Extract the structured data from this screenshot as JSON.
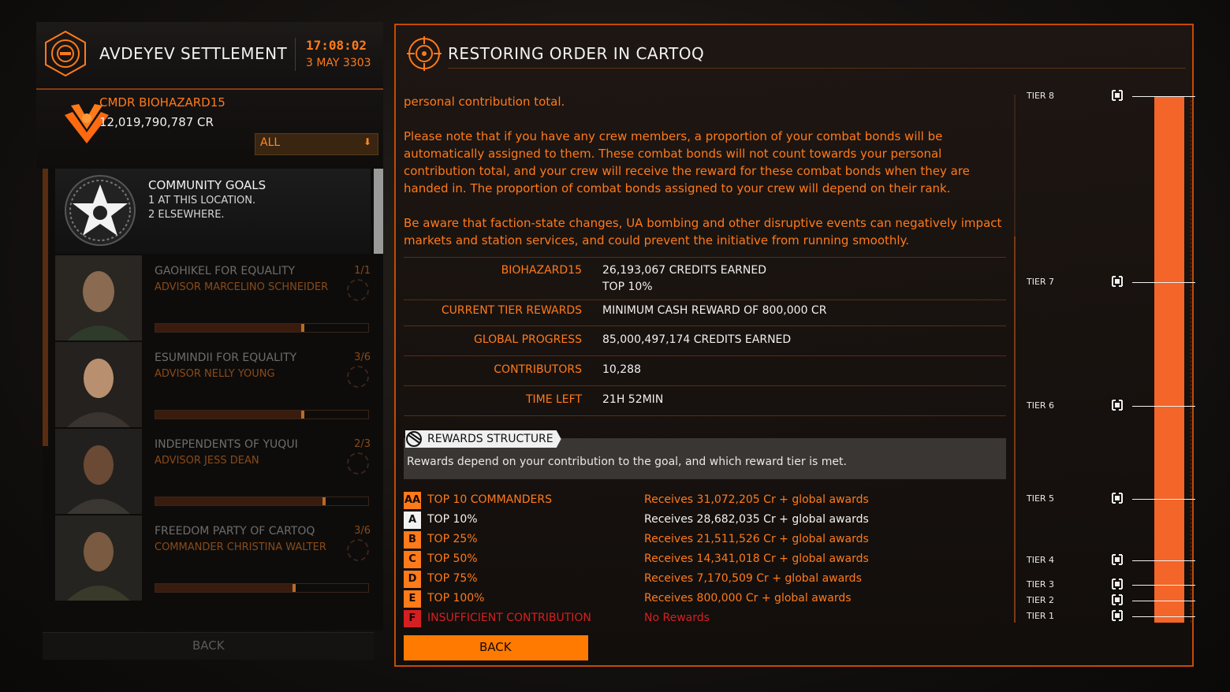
{
  "station": {
    "name": "AVDEYEV SETTLEMENT",
    "time": "17:08:02",
    "date": "3 MAY 3303"
  },
  "commander": {
    "name": "CMDR BIOHAZARD15",
    "credits": "12,019,790,787 CR",
    "filter": "ALL"
  },
  "community_goals": {
    "title": "COMMUNITY GOALS",
    "line1": "1 AT THIS LOCATION.",
    "line2": "2 ELSEWHERE."
  },
  "factions": [
    {
      "name": "GAOHIKEL FOR EQUALITY",
      "advisor": "ADVISOR MARCELINO SCHNEIDER",
      "count": "1/1",
      "progress": 0.7
    },
    {
      "name": "ESUMINDII FOR EQUALITY",
      "advisor": "ADVISOR NELLY YOUNG",
      "count": "3/6",
      "progress": 0.7
    },
    {
      "name": "INDEPENDENTS OF YUQUI",
      "advisor": "ADVISOR JESS DEAN",
      "count": "2/3",
      "progress": 0.8
    },
    {
      "name": "FREEDOM PARTY OF CARTOQ",
      "advisor": "COMMANDER CHRISTINA WALTER",
      "count": "3/6",
      "progress": 0.66
    }
  ],
  "left_back": "BACK",
  "goal": {
    "title": "RESTORING ORDER IN CARTOQ",
    "desc1": "personal contribution total.",
    "desc2": "Please note that if you have any crew members, a proportion of your combat bonds will be automatically assigned to them. These combat bonds will not count towards your personal contribution total, and your crew will receive the reward for these combat bonds when they are handed in. The proportion of combat bonds assigned to your crew will depend on their rank.",
    "desc3": "Be aware that faction-state changes, UA bombing and other disruptive events can negatively impact markets and station services, and could prevent the initiative from running smoothly."
  },
  "stats": [
    {
      "label": "BIOHAZARD15",
      "value": "26,193,067 CREDITS EARNED",
      "value2": "TOP 10%"
    },
    {
      "label": "CURRENT TIER REWARDS",
      "value": "MINIMUM CASH REWARD OF 800,000 CR"
    },
    {
      "label": "GLOBAL PROGRESS",
      "value": "85,000,497,174 CREDITS EARNED"
    },
    {
      "label": "CONTRIBUTORS",
      "value": "10,288"
    },
    {
      "label": "TIME LEFT",
      "value": "21H 52MIN"
    }
  ],
  "rewards": {
    "heading": "REWARDS STRUCTURE",
    "description": "Rewards depend on your contribution to the goal, and which reward tier is met.",
    "tiers": [
      {
        "badge": "AA",
        "label": "TOP 10 COMMANDERS",
        "reward": "Receives 31,072,205 Cr + global awards",
        "style": "orange"
      },
      {
        "badge": "A",
        "label": "TOP 10%",
        "reward": "Receives 28,682,035 Cr + global awards",
        "style": "white"
      },
      {
        "badge": "B",
        "label": "TOP 25%",
        "reward": "Receives 21,511,526 Cr + global awards",
        "style": "orange"
      },
      {
        "badge": "C",
        "label": "TOP 50%",
        "reward": "Receives 14,341,018 Cr + global awards",
        "style": "orange"
      },
      {
        "badge": "D",
        "label": "TOP 75%",
        "reward": "Receives 7,170,509 Cr + global awards",
        "style": "orange"
      },
      {
        "badge": "E",
        "label": "TOP 100%",
        "reward": "Receives 800,000 Cr + global awards",
        "style": "orange"
      },
      {
        "badge": "F",
        "label": "INSUFFICIENT CONTRIBUTION",
        "reward": "No Rewards",
        "style": "red"
      }
    ]
  },
  "tier_meter": {
    "labels": [
      "TIER 8",
      "TIER 7",
      "TIER 6",
      "TIER 5",
      "TIER 4",
      "TIER 3",
      "TIER 2",
      "TIER 1"
    ],
    "progress": 1.0
  },
  "right_back": "BACK",
  "colors": {
    "accent": "#ff7a1a",
    "meter": "#f36528",
    "back_button": "#ff7a00",
    "insufficient": "#d42020"
  }
}
